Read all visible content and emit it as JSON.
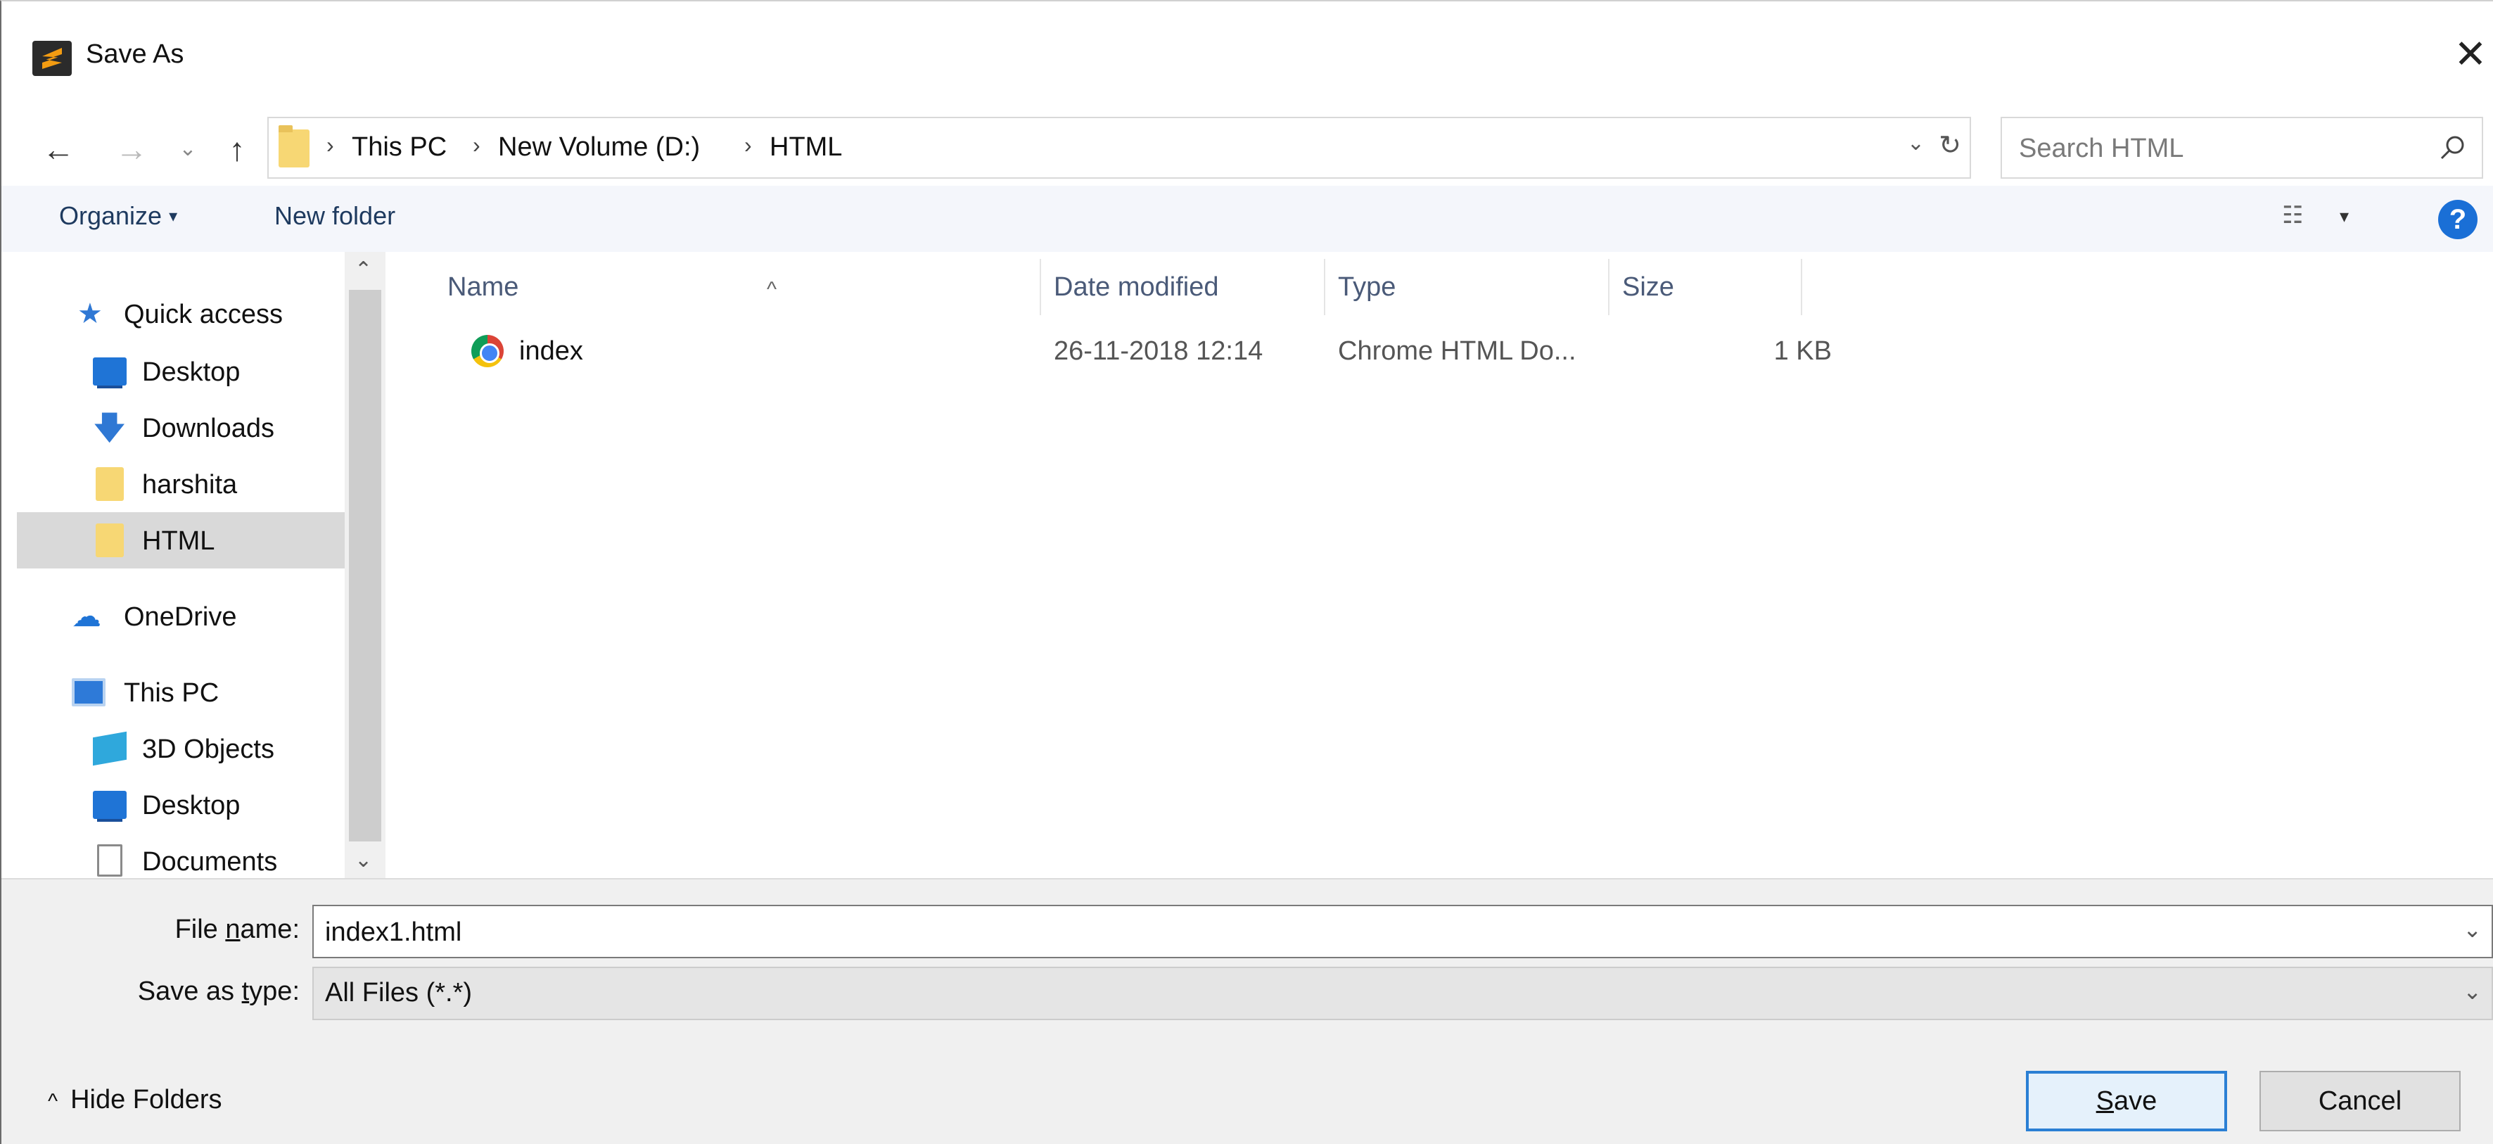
{
  "window": {
    "title": "Save As",
    "close": "✕"
  },
  "nav_buttons": {
    "back": "←",
    "forward": "→",
    "recent": "⌄",
    "up": "↑"
  },
  "address": {
    "crumbs": [
      "This PC",
      "New Volume (D:)",
      "HTML"
    ],
    "separator": "›",
    "dropdown": "⌄",
    "refresh": "↻"
  },
  "search": {
    "placeholder": "Search HTML"
  },
  "toolbar": {
    "organize": "Organize",
    "organize_caret": "▾",
    "new_folder": "New folder",
    "view_icon": "☷",
    "view_caret": "▾",
    "help": "?"
  },
  "nav_pane": {
    "items": [
      {
        "label": "Quick access",
        "icon": "star-icon"
      },
      {
        "label": "Desktop",
        "icon": "desktop-icon"
      },
      {
        "label": "Downloads",
        "icon": "download-icon"
      },
      {
        "label": "harshita",
        "icon": "folder-icon"
      },
      {
        "label": "HTML",
        "icon": "folder-icon",
        "selected": true
      },
      {
        "label": "OneDrive",
        "icon": "cloud-icon"
      },
      {
        "label": "This PC",
        "icon": "pc-icon"
      },
      {
        "label": "3D Objects",
        "icon": "cube-icon"
      },
      {
        "label": "Desktop",
        "icon": "desktop-icon"
      },
      {
        "label": "Documents",
        "icon": "document-icon"
      }
    ],
    "scroll_up": "⌃",
    "scroll_down": "⌄"
  },
  "file_list": {
    "columns": [
      "Name",
      "Date modified",
      "Type",
      "Size"
    ],
    "sort_caret": "^",
    "rows": [
      {
        "name": "index",
        "date": "26-11-2018 12:14",
        "type": "Chrome HTML Do...",
        "size": "1 KB"
      }
    ]
  },
  "fields": {
    "file_name_label_pre": "File ",
    "file_name_label_ul": "n",
    "file_name_label_post": "ame:",
    "file_name_value": "index1.html",
    "save_type_label_pre": "Save as ",
    "save_type_label_ul": "t",
    "save_type_label_post": "ype:",
    "save_type_value": "All Files (*.*)",
    "chevron": "⌄"
  },
  "footer": {
    "hide_folders": "Hide Folders",
    "hide_chevron": "^",
    "save_ul": "S",
    "save_rest": "ave",
    "cancel": "Cancel"
  },
  "colors": {
    "accent": "#2a7fd4",
    "selected_bg": "#d9d9d9",
    "toolbar_bg": "#f4f6fb",
    "help_blue": "#1a6fd6"
  }
}
